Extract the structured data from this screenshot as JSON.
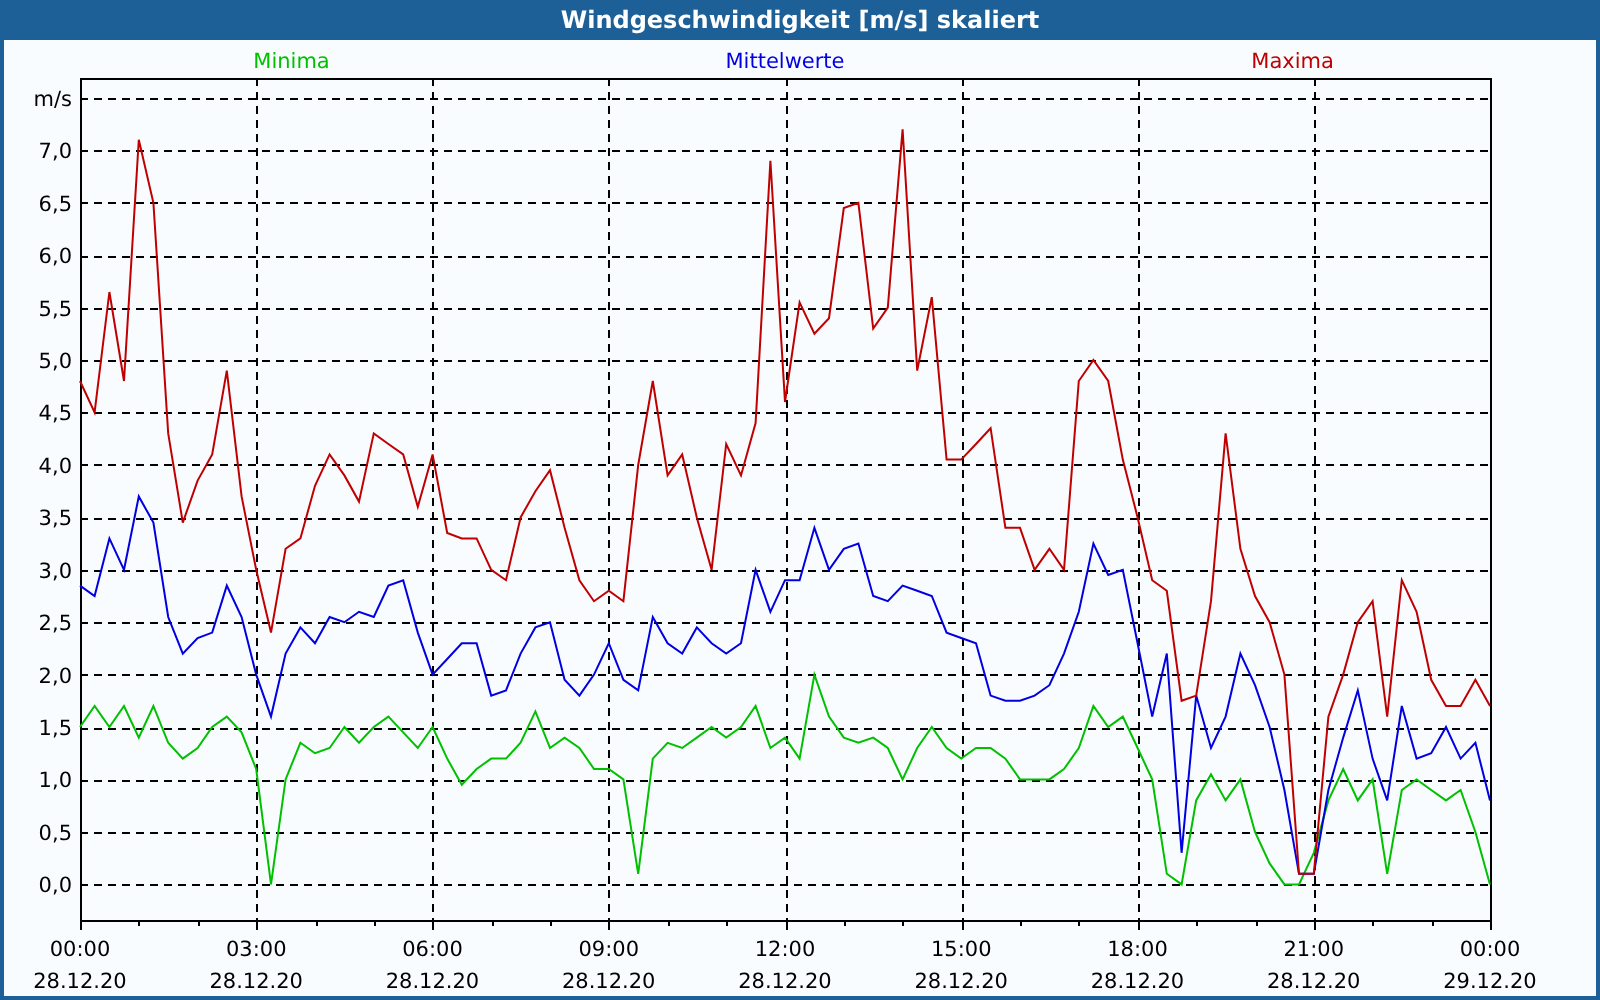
{
  "window": {
    "title": "Windgeschwindigkeit [m/s] skaliert"
  },
  "chart": {
    "chart_data": {
      "type": "line",
      "categories": [
        "00:00\n28.12.20",
        null,
        null,
        null,
        null,
        null,
        null,
        null,
        null,
        null,
        null,
        null,
        "03:00\n28.12.20",
        null,
        null,
        null,
        null,
        null,
        null,
        null,
        null,
        null,
        null,
        null,
        "06:00\n28.12.20",
        null,
        null,
        null,
        null,
        null,
        null,
        null,
        null,
        null,
        null,
        null,
        "09:00\n28.12.20",
        null,
        null,
        null,
        null,
        null,
        null,
        null,
        null,
        null,
        null,
        null,
        "12:00\n28.12.20",
        null,
        null,
        null,
        null,
        null,
        null,
        null,
        null,
        null,
        null,
        null,
        "15:00\n28.12.20",
        null,
        null,
        null,
        null,
        null,
        null,
        null,
        null,
        null,
        null,
        null,
        "18:00\n28.12.20",
        null,
        null,
        null,
        null,
        null,
        null,
        null,
        null,
        null,
        null,
        null,
        "21:00\n28.12.20",
        null,
        null,
        null,
        null,
        null,
        null,
        null,
        null,
        null,
        null,
        null,
        "00:00\n29.12.20"
      ],
      "series": [
        {
          "name": "Minima",
          "color": "#00c000",
          "values": [
            1.5,
            1.7,
            1.5,
            1.7,
            1.4,
            1.7,
            1.35,
            1.2,
            1.3,
            1.5,
            1.6,
            1.45,
            1.1,
            0.0,
            1.0,
            1.35,
            1.25,
            1.3,
            1.5,
            1.35,
            1.5,
            1.6,
            1.45,
            1.3,
            1.5,
            1.2,
            0.95,
            1.1,
            1.2,
            1.2,
            1.35,
            1.65,
            1.3,
            1.4,
            1.3,
            1.1,
            1.1,
            1.0,
            0.1,
            1.2,
            1.35,
            1.3,
            1.4,
            1.5,
            1.4,
            1.5,
            1.7,
            1.3,
            1.4,
            1.2,
            2.0,
            1.6,
            1.4,
            1.35,
            1.4,
            1.3,
            1.0,
            1.3,
            1.5,
            1.3,
            1.2,
            1.3,
            1.3,
            1.2,
            1.0,
            1.0,
            1.0,
            1.1,
            1.3,
            1.7,
            1.5,
            1.6,
            1.3,
            1.0,
            0.1,
            0.0,
            0.8,
            1.05,
            0.8,
            1.0,
            0.5,
            0.2,
            0.0,
            0.0,
            0.3,
            0.8,
            1.1,
            0.8,
            1.0,
            0.1,
            0.9,
            1.0,
            0.9,
            0.8,
            0.9,
            0.5,
            0.0
          ]
        },
        {
          "name": "Mittelwerte",
          "color": "#0000e0",
          "values": [
            2.85,
            2.75,
            3.3,
            3.0,
            3.7,
            3.45,
            2.55,
            2.2,
            2.35,
            2.4,
            2.85,
            2.55,
            2.0,
            1.6,
            2.2,
            2.45,
            2.3,
            2.55,
            2.5,
            2.6,
            2.55,
            2.85,
            2.9,
            2.4,
            2.0,
            2.15,
            2.3,
            2.3,
            1.8,
            1.85,
            2.2,
            2.45,
            2.5,
            1.95,
            1.8,
            2.0,
            2.3,
            1.95,
            1.85,
            2.55,
            2.3,
            2.2,
            2.45,
            2.3,
            2.2,
            2.3,
            3.0,
            2.6,
            2.9,
            2.9,
            3.4,
            3.0,
            3.2,
            3.25,
            2.75,
            2.7,
            2.85,
            2.8,
            2.75,
            2.4,
            2.35,
            2.3,
            1.8,
            1.75,
            1.75,
            1.8,
            1.9,
            2.2,
            2.6,
            3.25,
            2.95,
            3.0,
            2.3,
            1.6,
            2.2,
            0.3,
            1.8,
            1.3,
            1.6,
            2.2,
            1.9,
            1.5,
            0.9,
            0.1,
            0.1,
            0.9,
            1.4,
            1.85,
            1.2,
            0.8,
            1.7,
            1.2,
            1.25,
            1.5,
            1.2,
            1.35,
            0.8
          ]
        },
        {
          "name": "Maxima",
          "color": "#c00000",
          "values": [
            4.8,
            4.5,
            5.65,
            4.8,
            7.1,
            6.5,
            4.3,
            3.45,
            3.85,
            4.1,
            4.9,
            3.7,
            3.0,
            2.4,
            3.2,
            3.3,
            3.8,
            4.1,
            3.9,
            3.65,
            4.3,
            4.2,
            4.1,
            3.6,
            4.1,
            3.35,
            3.3,
            3.3,
            3.0,
            2.9,
            3.5,
            3.75,
            3.95,
            3.4,
            2.9,
            2.7,
            2.8,
            2.7,
            4.0,
            4.8,
            3.9,
            4.1,
            3.5,
            3.0,
            4.2,
            3.9,
            4.4,
            6.9,
            4.6,
            5.55,
            5.25,
            5.4,
            6.45,
            6.5,
            5.3,
            5.5,
            7.2,
            4.9,
            5.6,
            4.05,
            4.05,
            4.2,
            4.35,
            3.4,
            3.4,
            3.0,
            3.2,
            3.0,
            4.8,
            5.0,
            4.8,
            4.05,
            3.5,
            2.9,
            2.8,
            1.75,
            1.8,
            2.7,
            4.3,
            3.2,
            2.75,
            2.5,
            2.0,
            0.1,
            0.1,
            1.6,
            2.0,
            2.5,
            2.7,
            1.6,
            2.9,
            2.6,
            1.95,
            1.7,
            1.7,
            1.95,
            1.7
          ]
        }
      ],
      "grid": true,
      "ylim": [
        -0.34,
        7.69
      ],
      "yticks": [
        {
          "value": 0,
          "label": "0,0"
        },
        {
          "value": 0.5,
          "label": "0,5"
        },
        {
          "value": 1,
          "label": "1,0"
        },
        {
          "value": 1.5,
          "label": "1,5"
        },
        {
          "value": 2,
          "label": "2,0"
        },
        {
          "value": 2.5,
          "label": "2,5"
        },
        {
          "value": 3,
          "label": "3,0"
        },
        {
          "value": 3.5,
          "label": "3,5"
        },
        {
          "value": 4,
          "label": "4,0"
        },
        {
          "value": 4.5,
          "label": "4,5"
        },
        {
          "value": 5,
          "label": "5,0"
        },
        {
          "value": 5.5,
          "label": "5,5"
        },
        {
          "value": 6,
          "label": "6,0"
        },
        {
          "value": 6.5,
          "label": "6,5"
        },
        {
          "value": 7,
          "label": "7,0"
        },
        {
          "value": 7.5,
          "label": "m/s"
        }
      ]
    }
  }
}
